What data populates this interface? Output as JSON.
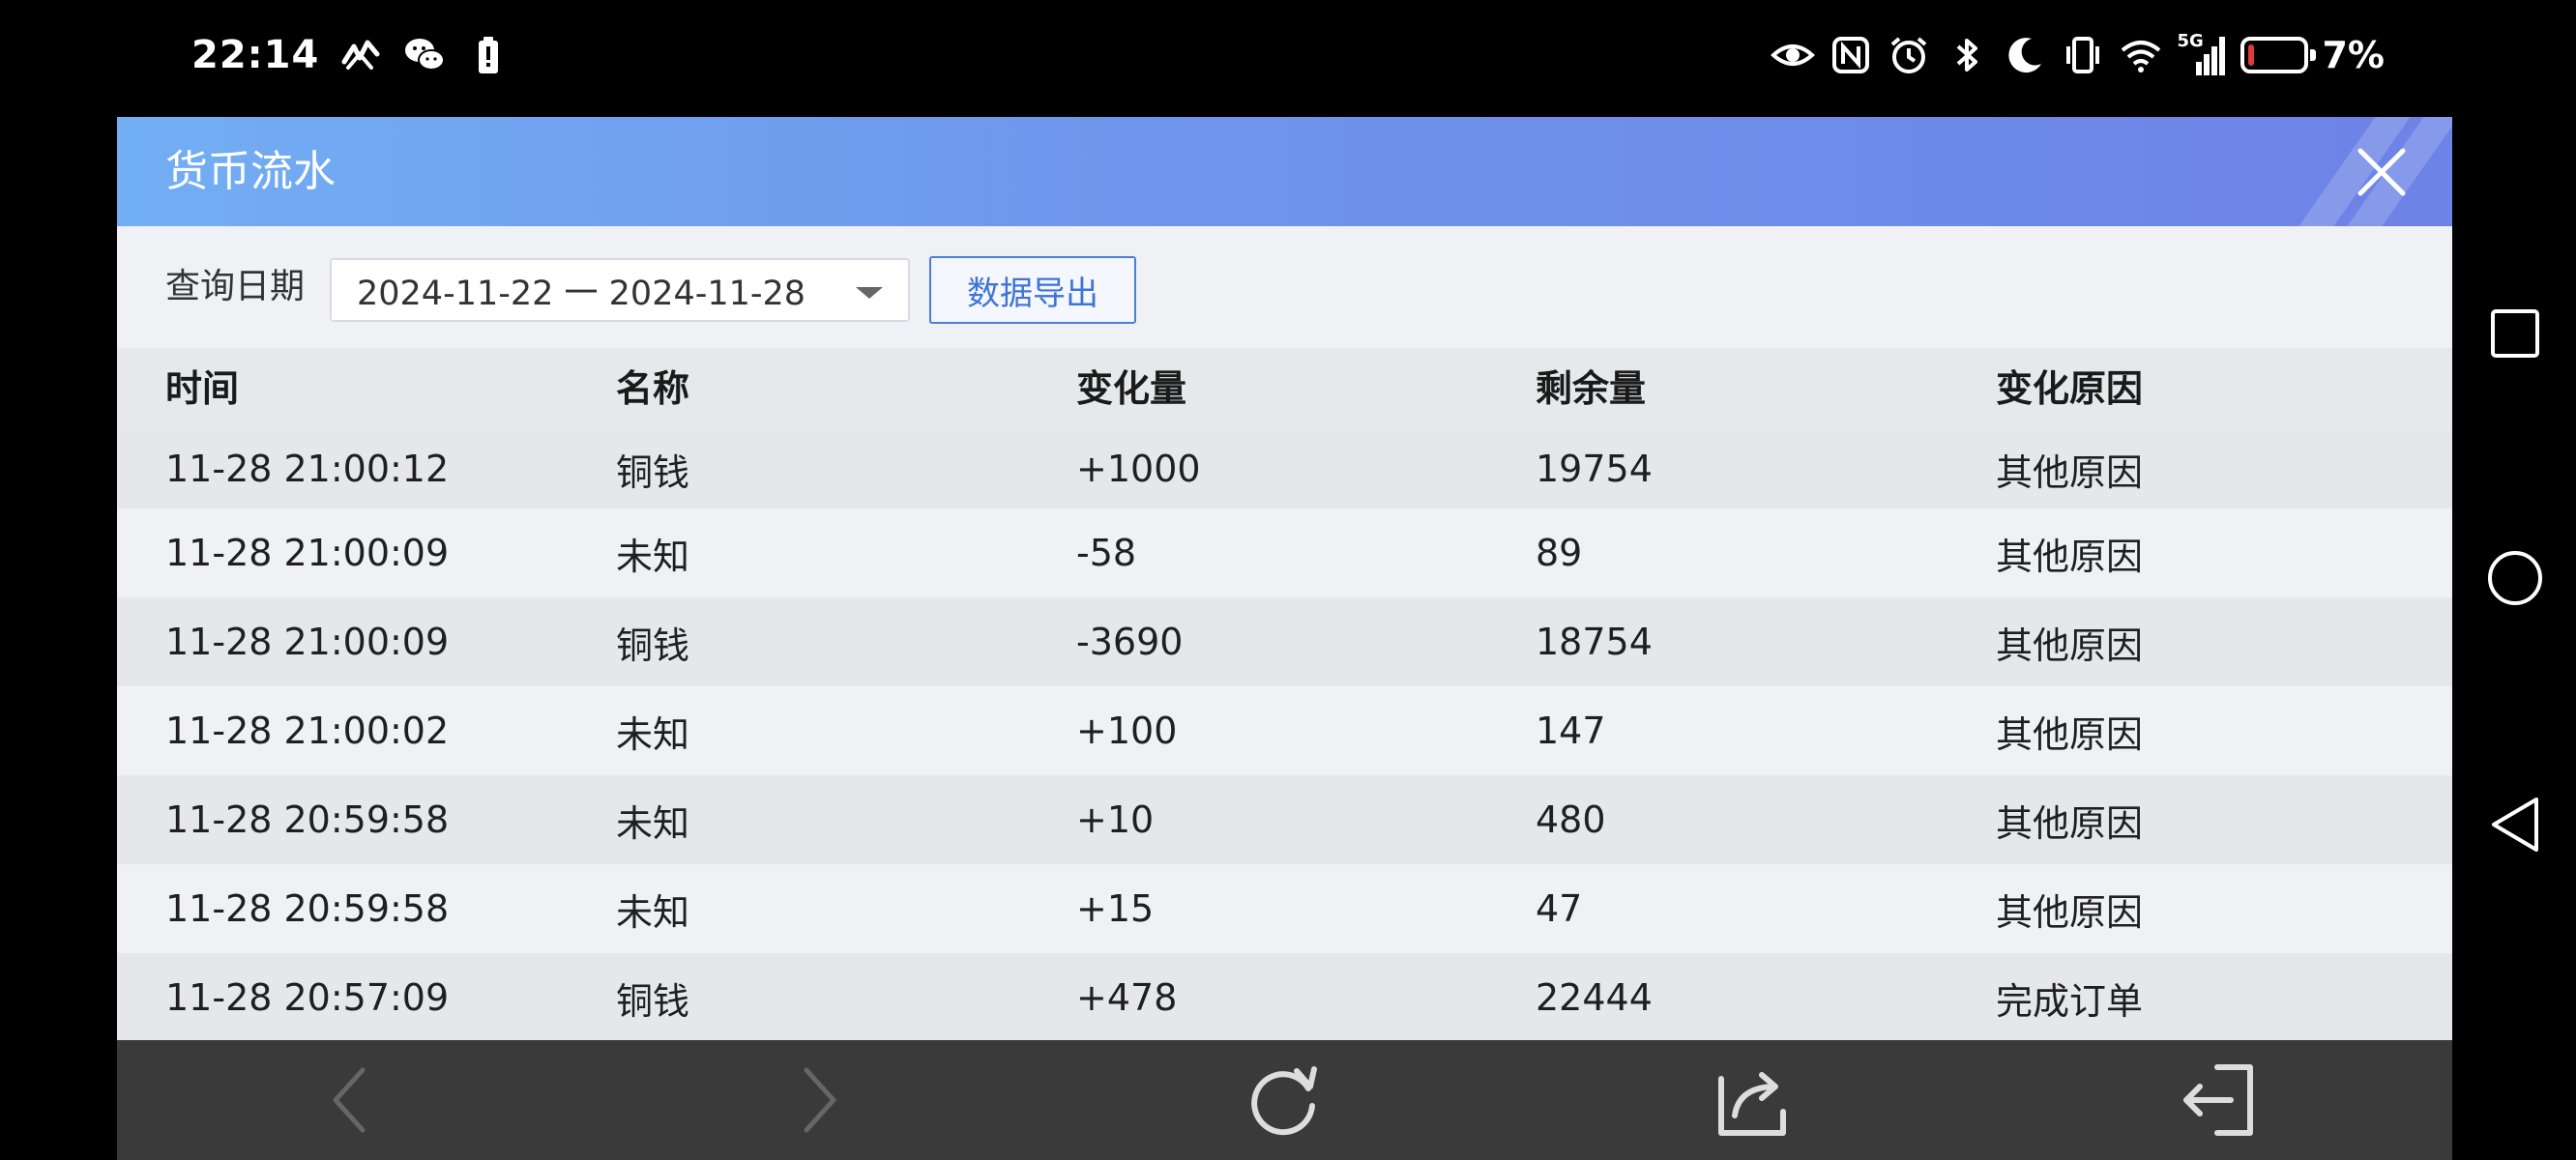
{
  "status_bar": {
    "time": "22:14",
    "network": "5G",
    "battery_percent": "7%",
    "battery_level": 0.07,
    "icons_left": [
      "heartbeat-link-icon",
      "wechat-icon",
      "battery-alert-icon"
    ],
    "icons_right": [
      "eye-icon",
      "nfc-icon",
      "alarm-icon",
      "bluetooth-icon",
      "moon-icon",
      "vibrate-icon",
      "wifi-icon",
      "signal-icon"
    ]
  },
  "dialog": {
    "title": "货币流水",
    "close_icon": "close-icon",
    "filter": {
      "label": "查询日期",
      "date_range": "2024-11-22 一 2024-11-28",
      "export_label": "数据导出"
    },
    "table": {
      "columns": [
        "时间",
        "名称",
        "变化量",
        "剩余量",
        "变化原因"
      ],
      "rows": [
        [
          "11-28 21:00:12",
          "铜钱",
          "+1000",
          "19754",
          "其他原因"
        ],
        [
          "11-28 21:00:09",
          "未知",
          "-58",
          "89",
          "其他原因"
        ],
        [
          "11-28 21:00:09",
          "铜钱",
          "-3690",
          "18754",
          "其他原因"
        ],
        [
          "11-28 21:00:02",
          "未知",
          "+100",
          "147",
          "其他原因"
        ],
        [
          "11-28 20:59:58",
          "未知",
          "+10",
          "480",
          "其他原因"
        ],
        [
          "11-28 20:59:58",
          "未知",
          "+15",
          "47",
          "其他原因"
        ],
        [
          "11-28 20:57:09",
          "铜钱",
          "+478",
          "22444",
          "完成订单"
        ]
      ]
    }
  },
  "toolbar": {
    "buttons": [
      "back-icon",
      "forward-icon",
      "refresh-icon",
      "share-icon",
      "exit-icon"
    ]
  },
  "system_nav": {
    "buttons": [
      "recent-apps-icon",
      "home-icon",
      "back-triangle-icon"
    ]
  },
  "colors": {
    "header_gradient_start": "#72aef3",
    "header_gradient_end": "#6d83e6",
    "export_accent": "#3f74d6",
    "battery_low": "#e03a3a"
  }
}
